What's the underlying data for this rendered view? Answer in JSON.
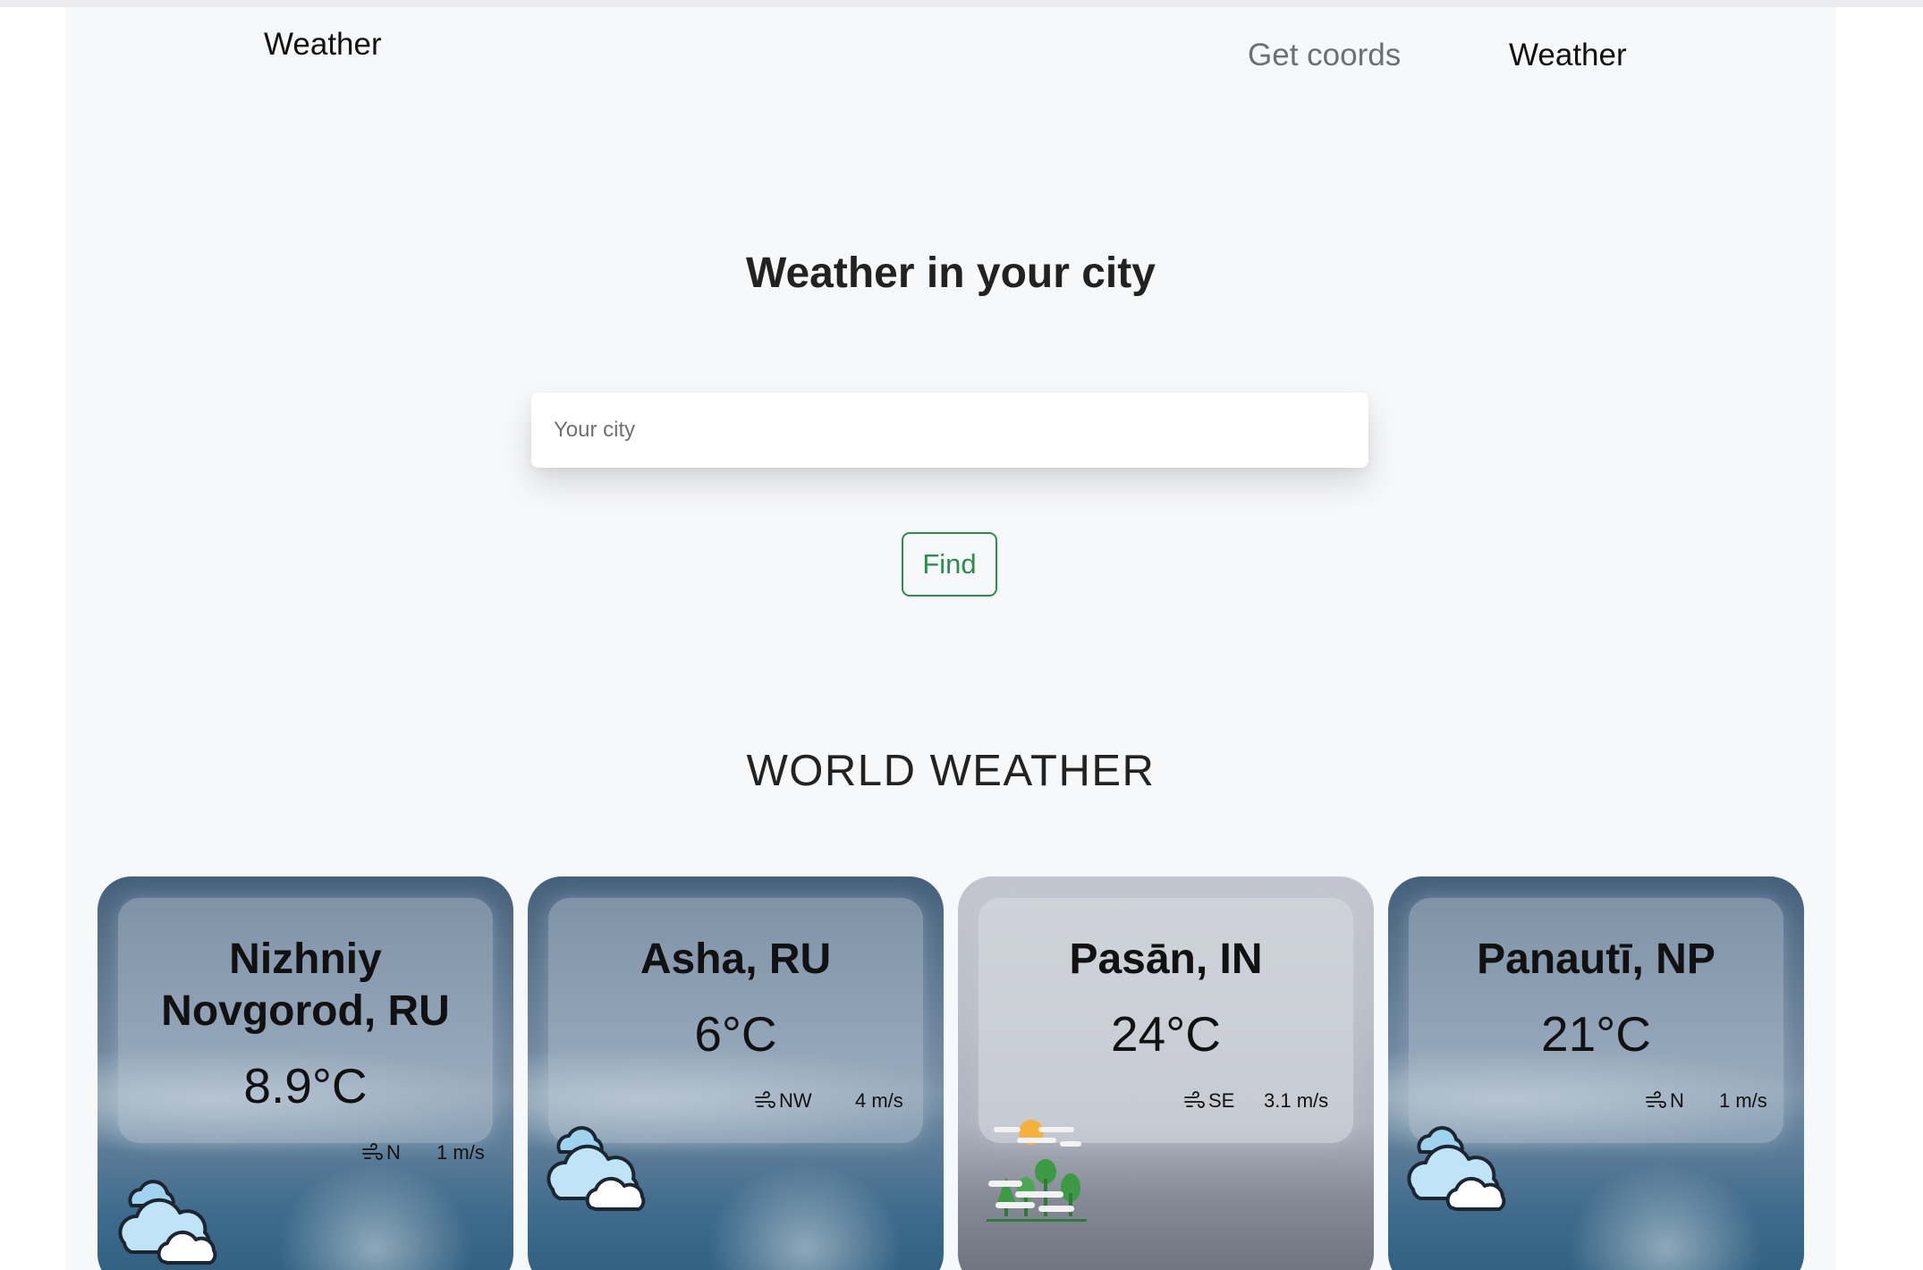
{
  "nav": {
    "brand": "Weather",
    "links": [
      "Get coords",
      "Weather"
    ]
  },
  "hero": {
    "title": "Weather in your city",
    "search_placeholder": "Your city",
    "find_label": "Find"
  },
  "world": {
    "title": "WORLD WEATHER",
    "cards": [
      {
        "city": "Nizhniy Novgorod, RU",
        "temp": "8.9°C",
        "wind_dir": "N",
        "wind_speed": "1 m/s",
        "icon": "cloudy-icon"
      },
      {
        "city": "Asha, RU",
        "temp": "6°C",
        "wind_dir": "NW",
        "wind_speed": "4 m/s",
        "icon": "cloudy-icon"
      },
      {
        "city": "Pasān, IN",
        "temp": "24°C",
        "wind_dir": "SE",
        "wind_speed": "3.1 m/s",
        "icon": "haze-icon"
      },
      {
        "city": "Panautī, NP",
        "temp": "21°C",
        "wind_dir": "N",
        "wind_speed": "1 m/s",
        "icon": "cloudy-icon"
      }
    ]
  },
  "colors": {
    "page_bg": "#f7f8fa",
    "accent_green": "#2e8b4e",
    "muted_link": "#6c6f73"
  }
}
